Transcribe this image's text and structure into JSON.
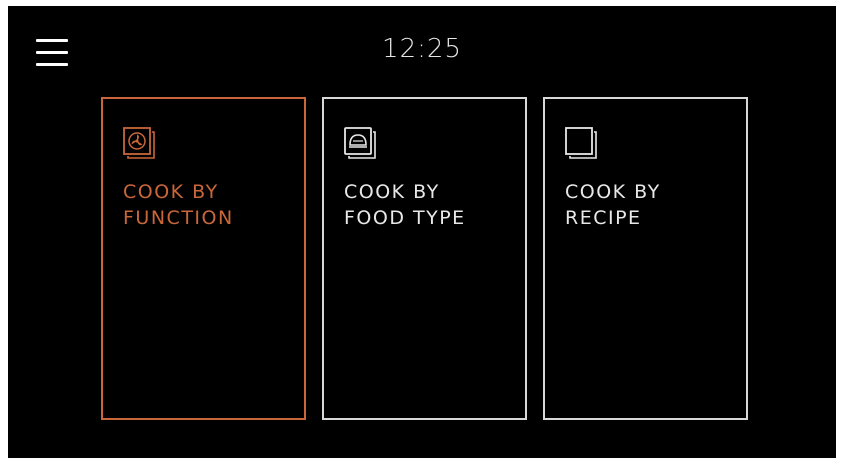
{
  "status": {
    "time": "12:25"
  },
  "menu": {
    "icon": "hamburger-menu-icon"
  },
  "tiles": [
    {
      "line1": "COOK BY",
      "line2": "FUNCTION",
      "icon": "fan-function-icon",
      "selected": true
    },
    {
      "line1": "COOK BY",
      "line2": "FOOD TYPE",
      "icon": "food-dome-icon",
      "selected": false
    },
    {
      "line1": "COOK BY",
      "line2": "RECIPE",
      "icon": "recipe-book-icon",
      "selected": false
    }
  ],
  "colors": {
    "background": "#000000",
    "accent": "#c9673a",
    "foreground": "#e8e8e8"
  }
}
